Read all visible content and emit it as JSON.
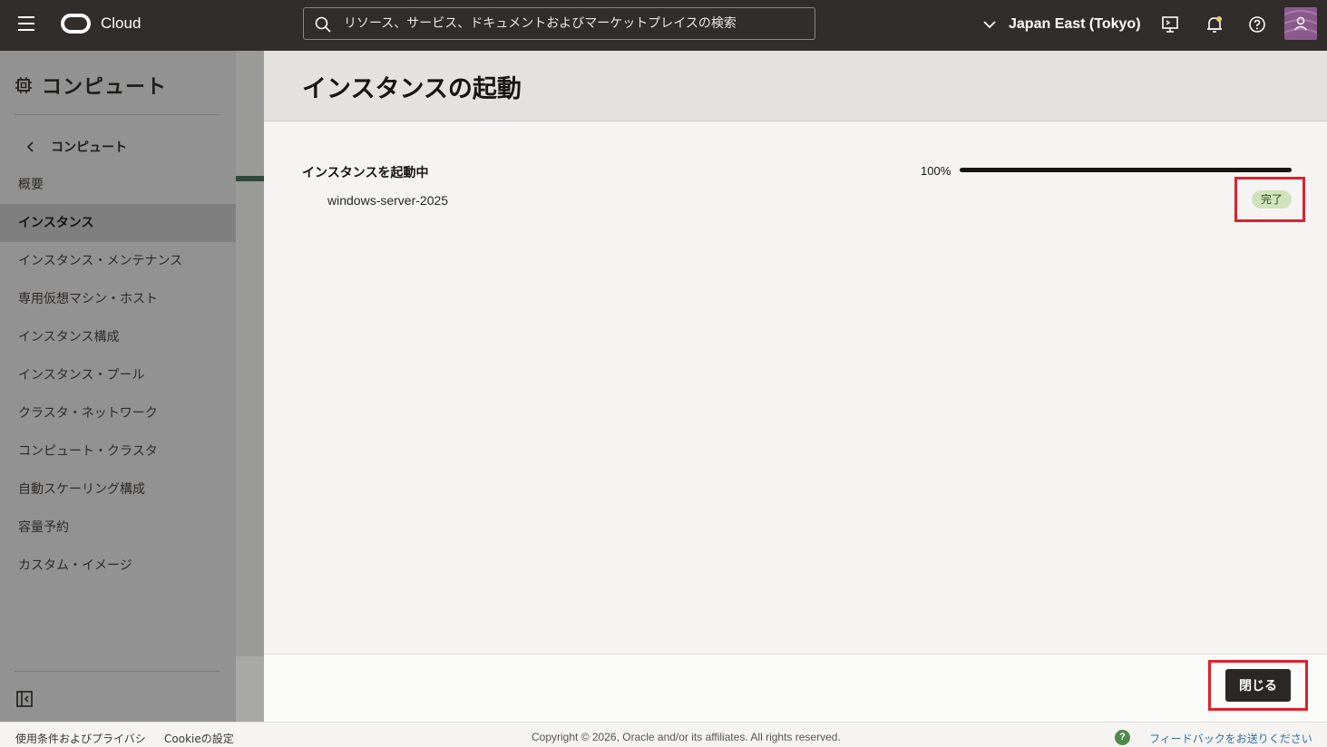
{
  "header": {
    "brand": "Cloud",
    "search_placeholder": "リソース、サービス、ドキュメントおよびマーケットプレイスの検索",
    "region": "Japan East (Tokyo)",
    "icons": [
      "menu-icon",
      "oracle-logo",
      "search-icon",
      "chevron-down-icon",
      "cloud-shell-icon",
      "bell-icon",
      "help-icon",
      "avatar"
    ]
  },
  "sidebar": {
    "title": "コンピュート",
    "back_label": "コンピュート",
    "items": [
      {
        "label": "概要",
        "active": false
      },
      {
        "label": "インスタンス",
        "active": true
      },
      {
        "label": "インスタンス・メンテナンス",
        "active": false
      },
      {
        "label": "専用仮想マシン・ホスト",
        "active": false
      },
      {
        "label": "インスタンス構成",
        "active": false
      },
      {
        "label": "インスタンス・プール",
        "active": false
      },
      {
        "label": "クラスタ・ネットワーク",
        "active": false
      },
      {
        "label": "コンピュート・クラスタ",
        "active": false
      },
      {
        "label": "自動スケーリング構成",
        "active": false
      },
      {
        "label": "容量予約",
        "active": false
      },
      {
        "label": "カスタム・イメージ",
        "active": false
      }
    ]
  },
  "panel": {
    "title": "インスタンスの起動",
    "task_label": "インスタンスを起動中",
    "progress_label": "100%",
    "progress_fraction": 1.0,
    "item_name": "windows-server-2025",
    "status_badge": "完了",
    "close_label": "閉じる"
  },
  "footer": {
    "terms": "使用条件およびプライバシ",
    "cookie": "Cookieの設定",
    "copyright": "Copyright © 2026, Oracle and/or its affiliates. All rights reserved.",
    "feedback": "フィードバックをお送りください"
  },
  "colors": {
    "header_bg": "#312d2a",
    "badge_bg": "#cfe3bd",
    "highlight": "#e0202c",
    "button_bg": "#2a2725"
  }
}
